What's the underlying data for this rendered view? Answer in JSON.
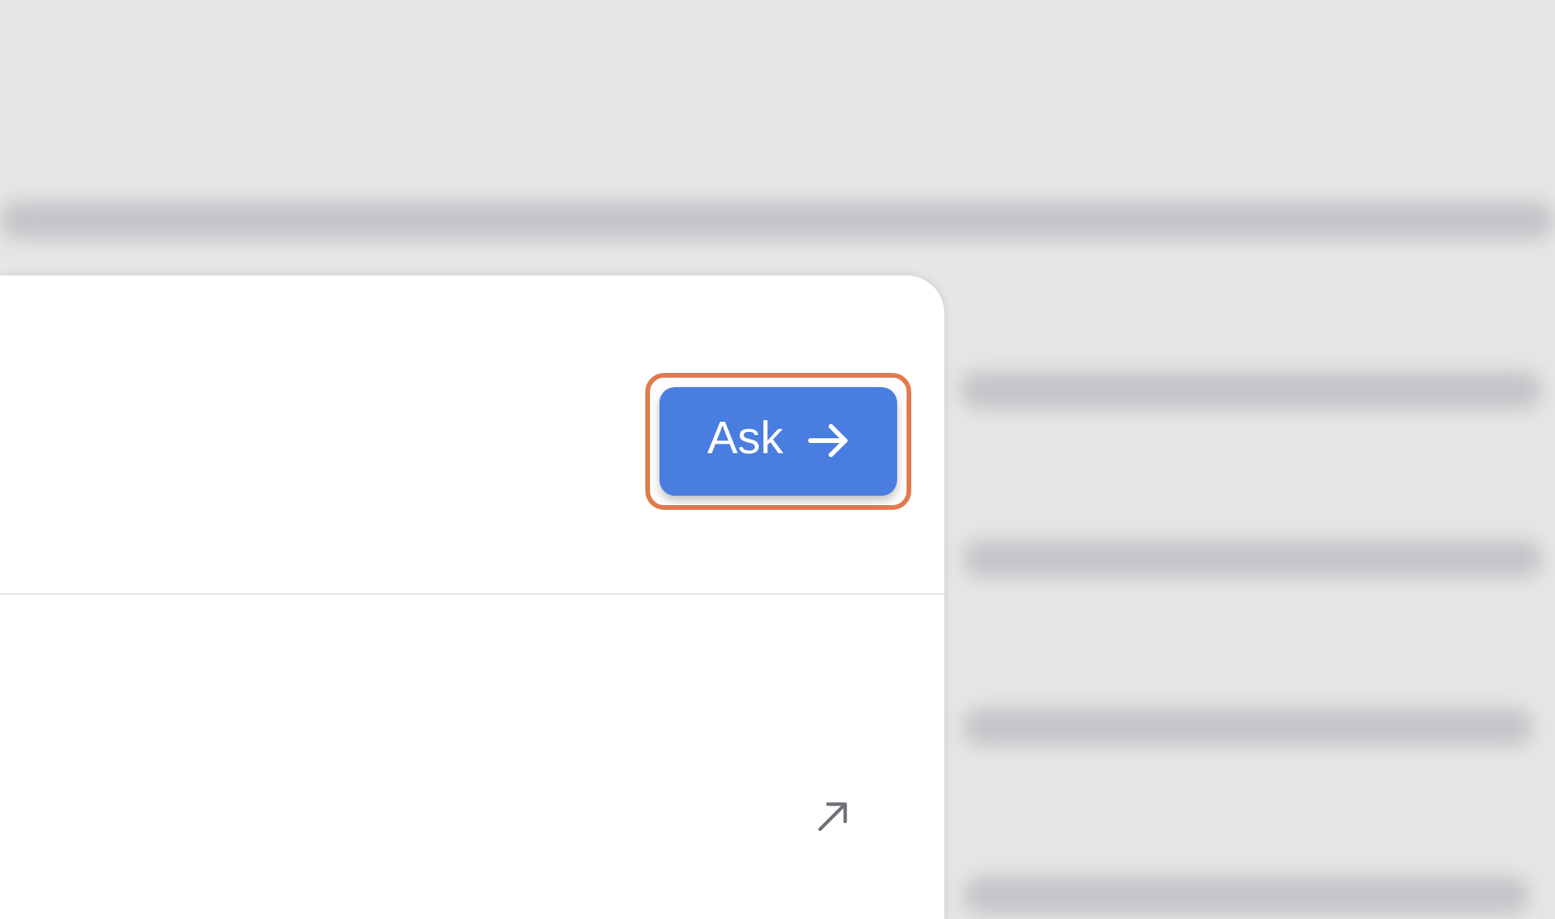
{
  "ask_button": {
    "label": "Ask",
    "highlighted": true
  }
}
